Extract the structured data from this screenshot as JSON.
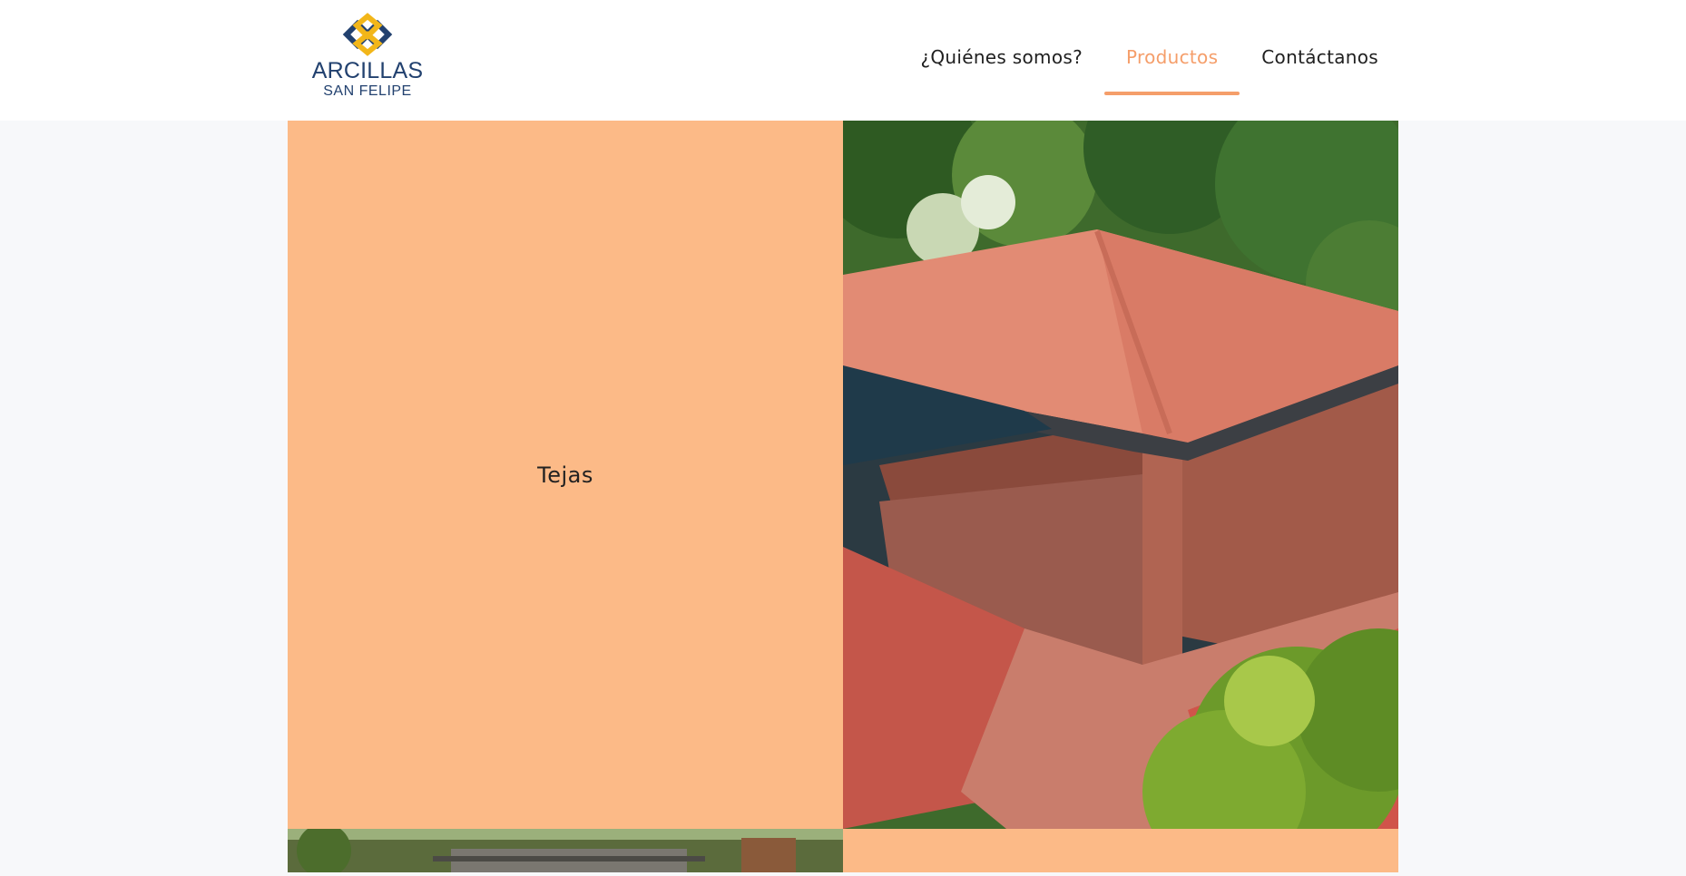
{
  "brand": {
    "name_line1": "ARCILLAS",
    "name_line2": "SAN FELIPE",
    "colors": {
      "navy": "#22416f",
      "gold": "#f2b619"
    }
  },
  "nav": {
    "items": [
      {
        "label": "¿Quiénes somos?",
        "active": false
      },
      {
        "label": "Productos",
        "active": true
      },
      {
        "label": "Contáctanos",
        "active": false
      }
    ],
    "accent_color": "#f59e6a"
  },
  "products": {
    "tiles": [
      {
        "label": "Tejas",
        "kind": "label",
        "color": "#fcba87"
      },
      {
        "kind": "photo",
        "subject": "clay tile roof pavilion"
      },
      {
        "kind": "photo",
        "subject": "factory yard"
      },
      {
        "kind": "label",
        "color": "#fcba87"
      }
    ]
  }
}
